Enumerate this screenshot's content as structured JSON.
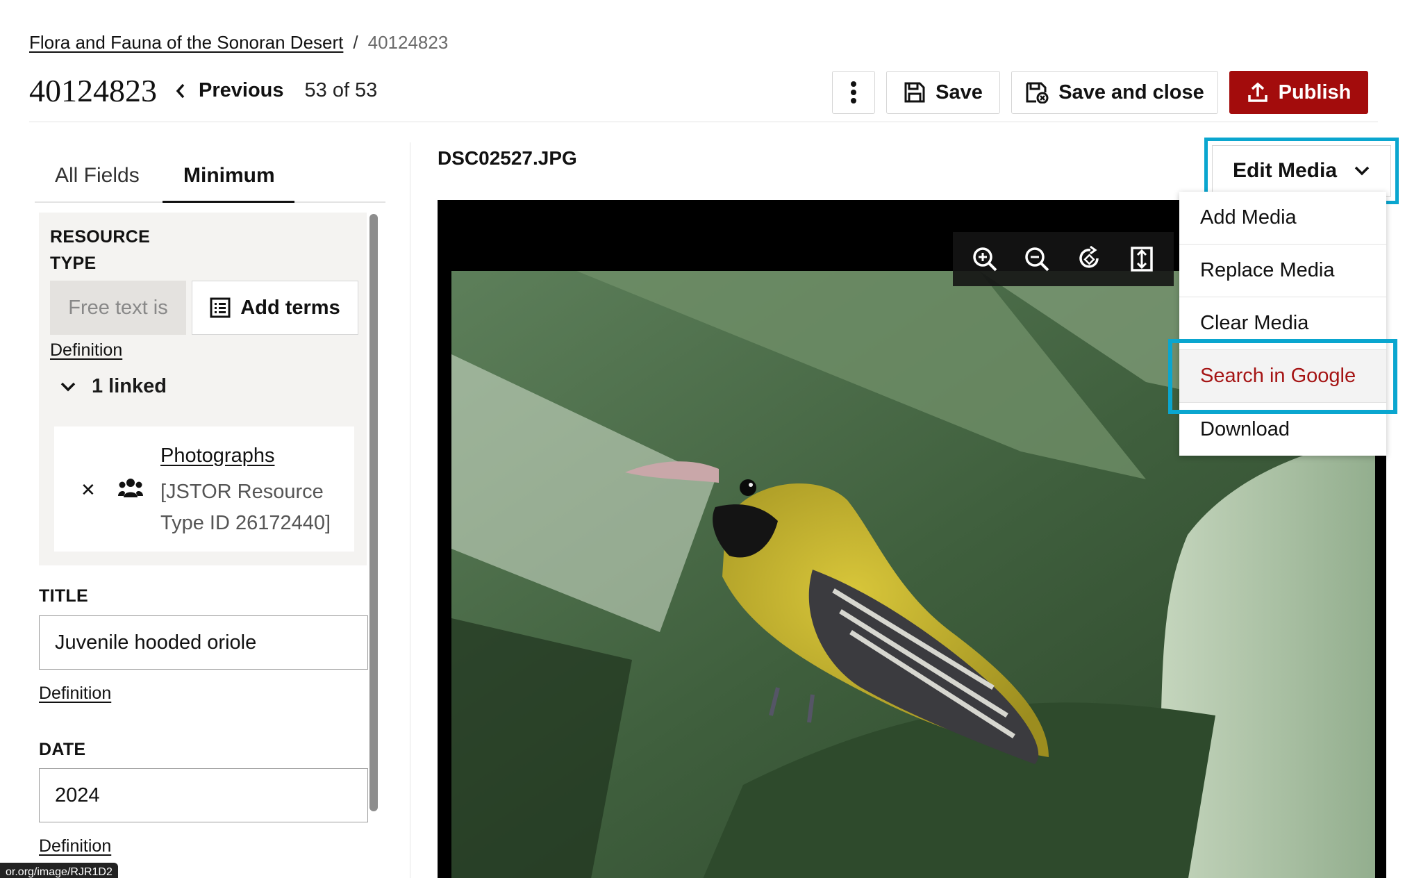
{
  "breadcrumb": {
    "collection": "Flora and Fauna of the Sonoran Desert",
    "separator": "/",
    "current": "40124823"
  },
  "header": {
    "record_id": "40124823",
    "previous_label": "Previous",
    "position": "53 of 53",
    "save_label": "Save",
    "save_close_label": "Save and close",
    "publish_label": "Publish"
  },
  "tabs": [
    {
      "label": "All Fields"
    },
    {
      "label": "Minimum",
      "active": true
    }
  ],
  "fields": {
    "resource_type": {
      "label": "RESOURCE TYPE",
      "free_text": "Free text is",
      "add_terms": "Add terms",
      "definition": "Definition",
      "linked_count": "1 linked",
      "linked_item": {
        "name": "Photographs",
        "detail": "[JSTOR Resource Type ID 26172440]"
      }
    },
    "title": {
      "label": "TITLE",
      "value": "Juvenile hooded oriole",
      "definition": "Definition"
    },
    "date": {
      "label": "DATE",
      "value": "2024",
      "definition": "Definition"
    }
  },
  "status_url": "or.org/image/RJR1D2",
  "media": {
    "filename": "DSC02527.JPG",
    "edit_media_label": "Edit Media",
    "menu": [
      {
        "label": "Add Media"
      },
      {
        "label": "Replace Media"
      },
      {
        "label": "Clear Media"
      },
      {
        "label": "Search in Google",
        "highlighted": true
      },
      {
        "label": "Download"
      }
    ],
    "viewer_tools": [
      "zoom-in-icon",
      "zoom-out-icon",
      "rotate-icon",
      "fit-icon"
    ]
  },
  "colors": {
    "publish": "#a30c0c",
    "focus_ring": "#0aa6cf",
    "highlight_text": "#a51414"
  }
}
